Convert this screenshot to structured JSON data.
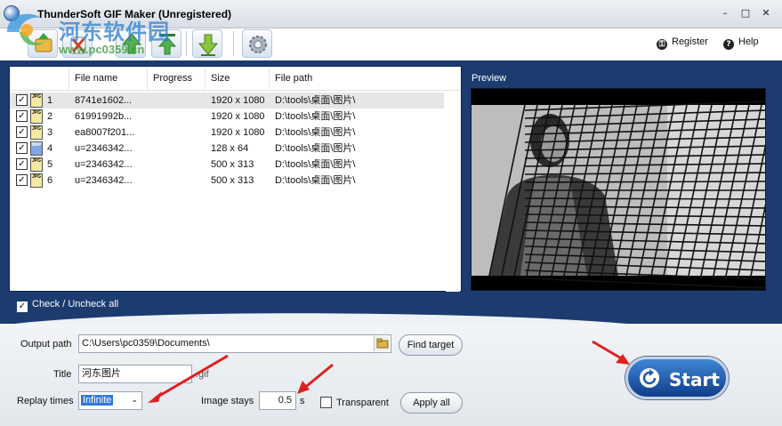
{
  "window": {
    "title": "ThunderSoft GIF Maker (Unregistered)",
    "minimize": "–",
    "maximize": "□",
    "close": "✕"
  },
  "watermark": {
    "cn_text": "河东软件园",
    "url": "www.pc0359.cn"
  },
  "toolbar": {
    "buttons": [
      "add-folder-icon",
      "remove-icon",
      "move-up-icon",
      "move-down-icon",
      "settings-icon"
    ],
    "register_label": "Register",
    "help_label": "Help"
  },
  "file_list": {
    "columns": [
      "File name",
      "Progress",
      "Size",
      "File path"
    ],
    "rows": [
      {
        "index": "1",
        "type": "JPG",
        "name": "8741e1602...",
        "progress": "",
        "size": "1920 x 1080",
        "path": "D:\\tools\\桌面\\图片\\"
      },
      {
        "index": "2",
        "type": "JPG",
        "name": "61991992b...",
        "progress": "",
        "size": "1920 x 1080",
        "path": "D:\\tools\\桌面\\图片\\"
      },
      {
        "index": "3",
        "type": "JPG",
        "name": "ea8007f201...",
        "progress": "",
        "size": "1920 x 1080",
        "path": "D:\\tools\\桌面\\图片\\"
      },
      {
        "index": "4",
        "type": "BMP",
        "name": "u=2346342...",
        "progress": "",
        "size": "128 x 64",
        "path": "D:\\tools\\桌面\\图片\\"
      },
      {
        "index": "5",
        "type": "JPG",
        "name": "u=2346342...",
        "progress": "",
        "size": "500 x 313",
        "path": "D:\\tools\\桌面\\图片\\"
      },
      {
        "index": "6",
        "type": "JPG",
        "name": "u=2346342...",
        "progress": "",
        "size": "500 x 313",
        "path": "D:\\tools\\桌面\\图片\\"
      }
    ],
    "check_all_label": "Check / Uncheck all",
    "check_mark": "✓"
  },
  "preview": {
    "label": "Preview"
  },
  "output": {
    "output_path_label": "Output path",
    "output_path_value": "C:\\Users\\pc0359\\Documents\\",
    "find_target_label": "Find target",
    "title_label": "Title",
    "title_value": "河东图片",
    "title_ext": ".gif",
    "replay_label": "Replay times",
    "replay_value": "Infinite",
    "image_stays_label": "Image stays",
    "image_stays_value": "0.5",
    "image_stays_unit": "s",
    "transparent_label": "Transparent",
    "apply_all_label": "Apply all",
    "start_label": "Start"
  },
  "colors": {
    "main_panel": "#1c3c70",
    "start_button": "#1f5aa8",
    "annotation_arrow": "#e02020"
  }
}
